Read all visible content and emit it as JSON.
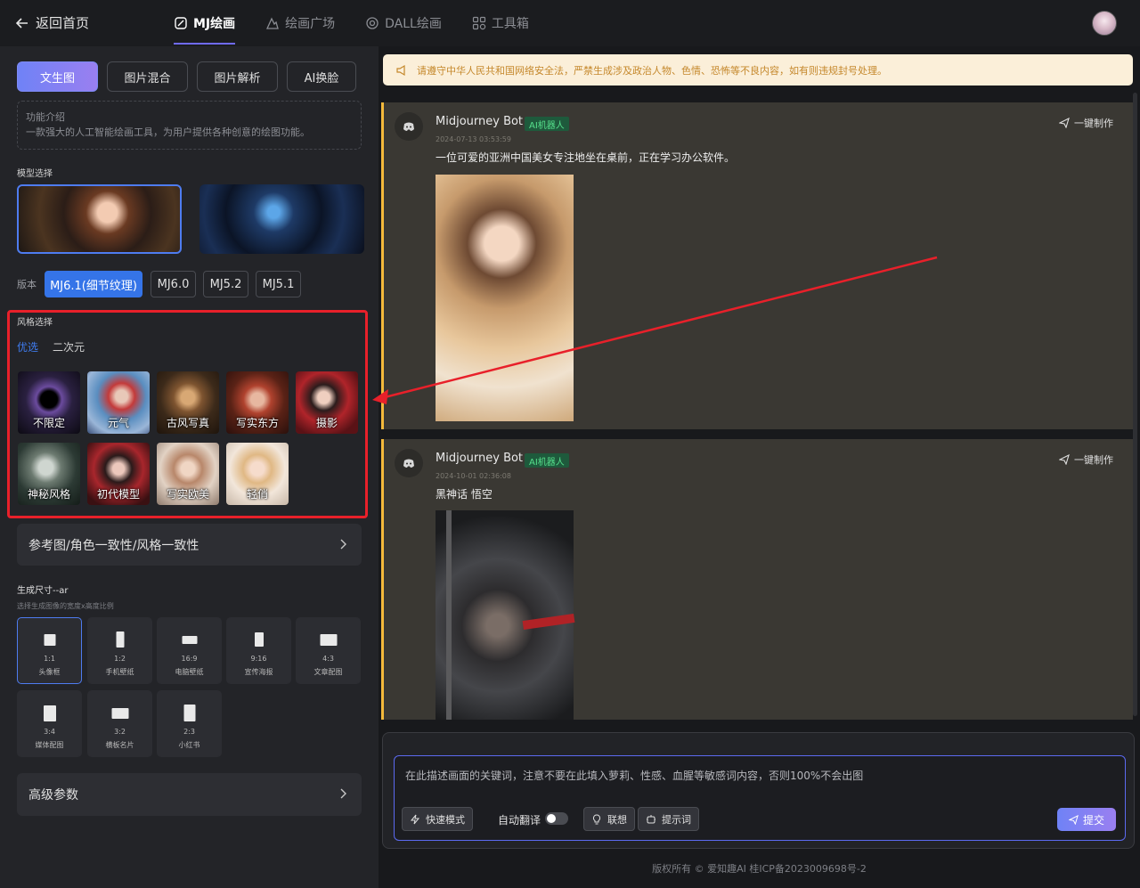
{
  "topbar": {
    "back_label": "返回首页",
    "tabs": [
      {
        "label": "MJ绘画",
        "active": true
      },
      {
        "label": "绘画广场",
        "active": false
      },
      {
        "label": "DALL绘画",
        "active": false
      },
      {
        "label": "工具箱",
        "active": false
      }
    ]
  },
  "left": {
    "mode_tabs": [
      "文生图",
      "图片混合",
      "图片解析",
      "AI换脸"
    ],
    "intro_title": "功能介绍",
    "intro_text": "一款强大的人工智能绘画工具，为用户提供各种创意的绘图功能。",
    "model_label": "模型选择",
    "version_label": "版本",
    "versions": [
      "MJ6.1(细节纹理)",
      "MJ6.0",
      "MJ5.2",
      "MJ5.1"
    ],
    "style_label": "风格选择",
    "style_tabs": [
      "优选",
      "二次元"
    ],
    "styles": [
      "不限定",
      "元气",
      "古风写真",
      "写实东方",
      "摄影",
      "神秘风格",
      "初代模型",
      "写实欧美",
      "轻俏"
    ],
    "ref_label": "参考图/角色一致性/风格一致性",
    "size_title": "生成尺寸--ar",
    "size_desc": "选择生成图像的宽度x高度比例",
    "sizes": [
      {
        "ratio": "1:1",
        "name": "头像框"
      },
      {
        "ratio": "1:2",
        "name": "手机壁纸"
      },
      {
        "ratio": "16:9",
        "name": "电脑壁纸"
      },
      {
        "ratio": "9:16",
        "name": "宣传海报"
      },
      {
        "ratio": "4:3",
        "name": "文章配图"
      },
      {
        "ratio": "3:4",
        "name": "媒体配图"
      },
      {
        "ratio": "3:2",
        "name": "横板名片"
      },
      {
        "ratio": "2:3",
        "name": "小红书"
      }
    ],
    "adv_label": "高级参数"
  },
  "right": {
    "notice": "请遵守中华人民共和国网络安全法，严禁生成涉及政治人物、色情、恐怖等不良内容，如有则违规封号处理。",
    "messages": [
      {
        "name": "Midjourney Bot",
        "badge": "AI机器人",
        "time": "2024-07-13 03:53:59",
        "text": "一位可爱的亚洲中国美女专注地坐在桌前，正在学习办公软件。",
        "action": "一键制作"
      },
      {
        "name": "Midjourney Bot",
        "badge": "AI机器人",
        "time": "2024-10-01 02:36:08",
        "text": "黑神话 悟空",
        "action": "一键制作"
      }
    ],
    "input_placeholder": "在此描述画面的关键词，注意不要在此填入萝莉、性感、血腥等敏感词内容，否则100%不会出图",
    "fast_mode": "快速模式",
    "auto_translate": "自动翻译",
    "associate": "联想",
    "prompt_words": "提示词",
    "submit": "提交",
    "footer": "版权所有 © 爱知趣AI  桂ICP备2023009698号-2"
  },
  "colors": {
    "accent": "#6f82f6",
    "highlight": "#e8202a",
    "message_border": "#f4b93b"
  }
}
